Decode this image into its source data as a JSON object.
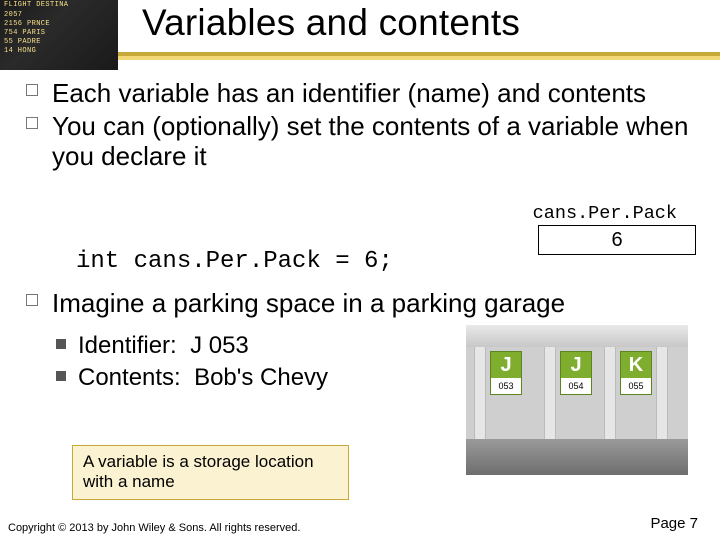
{
  "title": "Variables and contents",
  "bullets": {
    "b1": "Each variable has an identifier (name) and contents",
    "b2": "You can (optionally) set the contents of a variable when you declare it",
    "b3": "Imagine a parking space in a parking garage"
  },
  "code": "int cans.Per.Pack = 6;",
  "var_label": "cans.Per.Pack",
  "var_value": "6",
  "sub": {
    "s1_label": "Identifier:",
    "s1_value": "J 053",
    "s2_label": "Contents:",
    "s2_value": "Bob's Chevy"
  },
  "garage_signs": [
    {
      "letter": "J",
      "num": "053"
    },
    {
      "letter": "J",
      "num": "054"
    },
    {
      "letter": "K",
      "num": "055"
    }
  ],
  "callout": "A variable is a storage location with a name",
  "copyright": "Copyright © 2013 by John Wiley & Sons. All rights reserved.",
  "page": "Page 7",
  "board_rows": [
    "FLIGHT  DESTINA",
    "2057",
    "2156  PRNCE",
    "754   PARIS",
    "55    PADRE",
    "14    HONG"
  ]
}
